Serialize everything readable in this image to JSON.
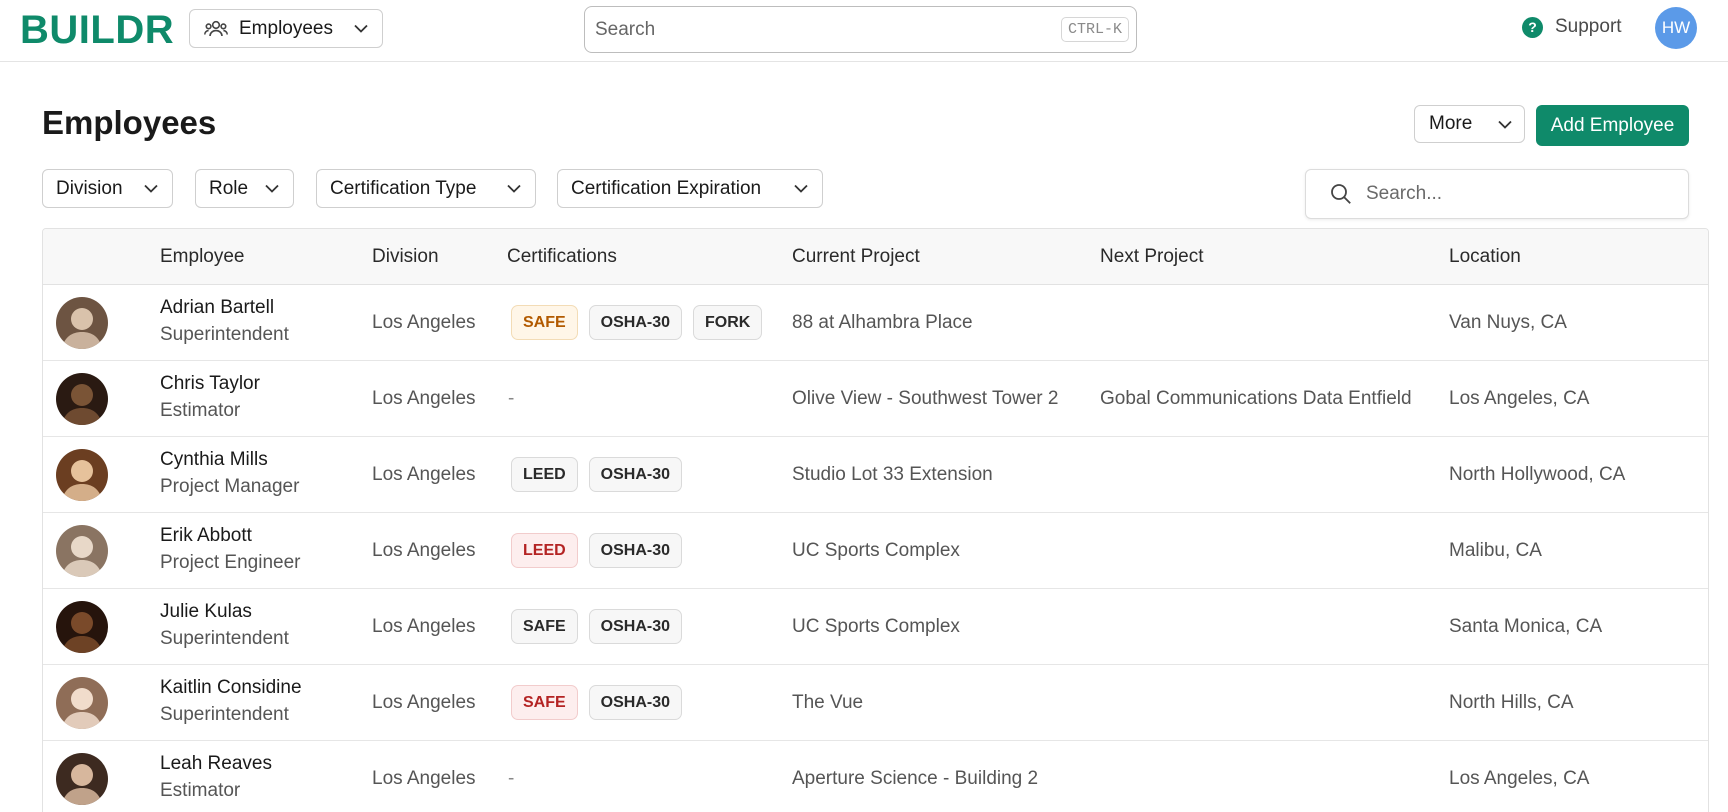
{
  "app": {
    "logo": "BUILDR",
    "module": "Employees"
  },
  "search": {
    "placeholder": "Search",
    "shortcut": "CTRL-K"
  },
  "header_right": {
    "support": "Support",
    "user_initials": "HW"
  },
  "page": {
    "title": "Employees",
    "more_label": "More",
    "add_label": "Add Employee"
  },
  "filters": [
    "Division",
    "Role",
    "Certification Type",
    "Certification Expiration"
  ],
  "table_search": {
    "placeholder": "Search..."
  },
  "columns": [
    "Employee",
    "Division",
    "Certifications",
    "Current Project",
    "Next Project",
    "Location"
  ],
  "rows": [
    {
      "name": "Adrian Bartell",
      "role": "Superintendent",
      "division": "Los Angeles",
      "certs": [
        {
          "label": "SAFE",
          "status": "warn"
        },
        {
          "label": "OSHA-30",
          "status": "ok"
        },
        {
          "label": "FORK",
          "status": "ok"
        }
      ],
      "cert_text": "",
      "current_project": "88 at Alhambra Place",
      "next_project": "",
      "location": "Van Nuys, CA"
    },
    {
      "name": "Chris Taylor",
      "role": "Estimator",
      "division": "Los Angeles",
      "certs": [],
      "cert_text": "-",
      "current_project": "Olive View - Southwest Tower 2",
      "next_project": "Gobal Communications Data Entfield",
      "location": "Los Angeles, CA"
    },
    {
      "name": "Cynthia Mills",
      "role": "Project Manager",
      "division": "Los Angeles",
      "certs": [
        {
          "label": "LEED",
          "status": "ok"
        },
        {
          "label": "OSHA-30",
          "status": "ok"
        }
      ],
      "cert_text": "",
      "current_project": "Studio Lot 33 Extension",
      "next_project": "",
      "location": "North Hollywood, CA"
    },
    {
      "name": "Erik Abbott",
      "role": "Project Engineer",
      "division": "Los Angeles",
      "certs": [
        {
          "label": "LEED",
          "status": "danger"
        },
        {
          "label": "OSHA-30",
          "status": "ok"
        }
      ],
      "cert_text": "",
      "current_project": "UC Sports Complex",
      "next_project": "",
      "location": "Malibu, CA"
    },
    {
      "name": "Julie Kulas",
      "role": "Superintendent",
      "division": "Los Angeles",
      "certs": [
        {
          "label": "SAFE",
          "status": "ok"
        },
        {
          "label": "OSHA-30",
          "status": "ok"
        }
      ],
      "cert_text": "",
      "current_project": "UC Sports Complex",
      "next_project": "",
      "location": "Santa Monica, CA"
    },
    {
      "name": "Kaitlin Considine",
      "role": "Superintendent",
      "division": "Los Angeles",
      "certs": [
        {
          "label": "SAFE",
          "status": "danger"
        },
        {
          "label": "OSHA-30",
          "status": "ok"
        }
      ],
      "cert_text": "",
      "current_project": "The Vue",
      "next_project": "",
      "location": "North Hills, CA"
    },
    {
      "name": "Leah Reaves",
      "role": "Estimator",
      "division": "Los Angeles",
      "certs": [],
      "cert_text": "-",
      "current_project": "Aperture Science - Building 2",
      "next_project": "",
      "location": "Los Angeles, CA"
    }
  ],
  "colors": {
    "brand": "#0f8a6a",
    "user_avatar": "#5b9ae8",
    "warn_text": "#b25a00",
    "danger_text": "#b42323"
  },
  "icons": {
    "module": "people-icon",
    "search": "search-icon",
    "support": "help-circle-icon",
    "chevron": "chevron-down-icon"
  }
}
